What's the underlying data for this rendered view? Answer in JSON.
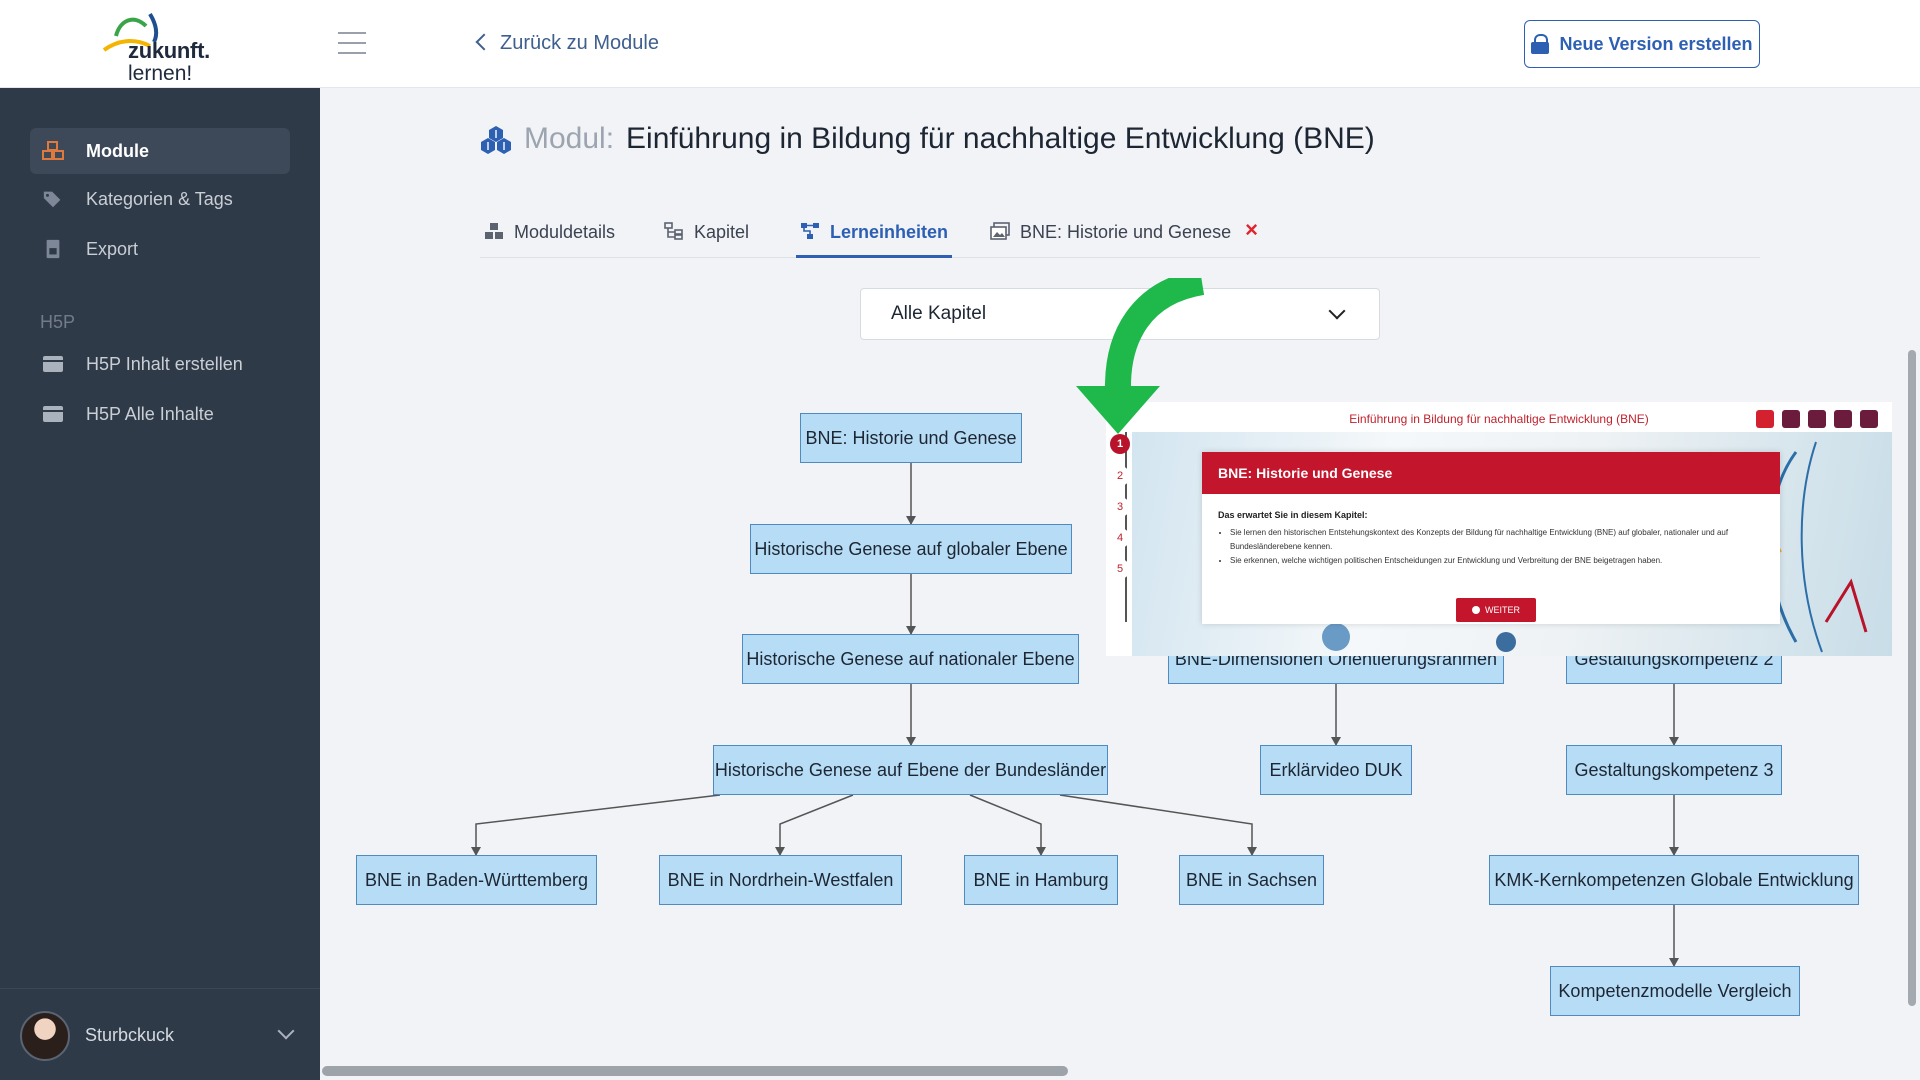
{
  "logo": {
    "word1": "zukunft.",
    "word2": "lernen!"
  },
  "header": {
    "back_label": "Zurück zu Module",
    "new_version_label": "Neue Version erstellen"
  },
  "sidebar": {
    "items": [
      {
        "label": "Module",
        "icon": "cubes-icon"
      },
      {
        "label": "Kategorien & Tags",
        "icon": "tags-icon"
      },
      {
        "label": "Export",
        "icon": "export-icon"
      }
    ],
    "section": "H5P",
    "h5p_items": [
      {
        "label": "H5P Inhalt erstellen",
        "icon": "h5p-icon"
      },
      {
        "label": "H5P Alle Inhalte",
        "icon": "h5p-icon"
      }
    ],
    "user": {
      "name": "Sturbckuck"
    }
  },
  "page": {
    "title_prefix": "Modul:",
    "title": "Einführung in Bildung für nachhaltige Entwicklung (BNE)"
  },
  "tabs": [
    {
      "label": "Moduldetails"
    },
    {
      "label": "Kapitel"
    },
    {
      "label": "Lerneinheiten"
    },
    {
      "label": "BNE: Historie und Genese",
      "close": "×"
    }
  ],
  "filter": {
    "selected": "Alle Kapitel"
  },
  "tree": {
    "nodes": [
      "BNE: Historie und Genese",
      "Historische Genese auf globaler Ebene",
      "Historische Genese auf nationaler Ebene",
      "Historische Genese auf Ebene der Bundesländer",
      "BNE in Baden-Württemberg",
      "BNE in Nordrhein-Westfalen",
      "BNE in Hamburg",
      "BNE in Sachsen",
      "BNE-Dimensionen Orientierungsrahmen",
      "Erklärvideo DUK",
      "Gestaltungskompetenz 2",
      "Gestaltungskompetenz 3",
      "KMK-Kernkompetenzen Globale Entwicklung",
      "Kompetenzmodelle Vergleich"
    ]
  },
  "preview": {
    "title": "Einführung in Bildung für nachhaltige Entwicklung (BNE)",
    "steps": [
      "1",
      "2",
      "3",
      "4",
      "5"
    ],
    "card_title": "BNE: Historie und Genese",
    "subtitle": "Das erwartet Sie in diesem Kapitel:",
    "bullets": [
      "Sie lernen den historischen Entstehungskontext des Konzepts der Bildung für nachhaltige Entwicklung (BNE) auf globaler, nationaler und auf Bundesländerebene kennen.",
      "Sie erkennen, welche wichtigen politischen Entscheidungen zur Entwicklung und Verbreitung der BNE beigetragen haben."
    ],
    "button": "WEITER"
  },
  "colors": {
    "accent": "#2d5fb3",
    "sidebar_bg": "#2f3a48",
    "node_fill": "#b7dcf5",
    "node_border": "#4f8bbf",
    "preview_red": "#c3152b",
    "arrow_green": "#1fb84a"
  }
}
